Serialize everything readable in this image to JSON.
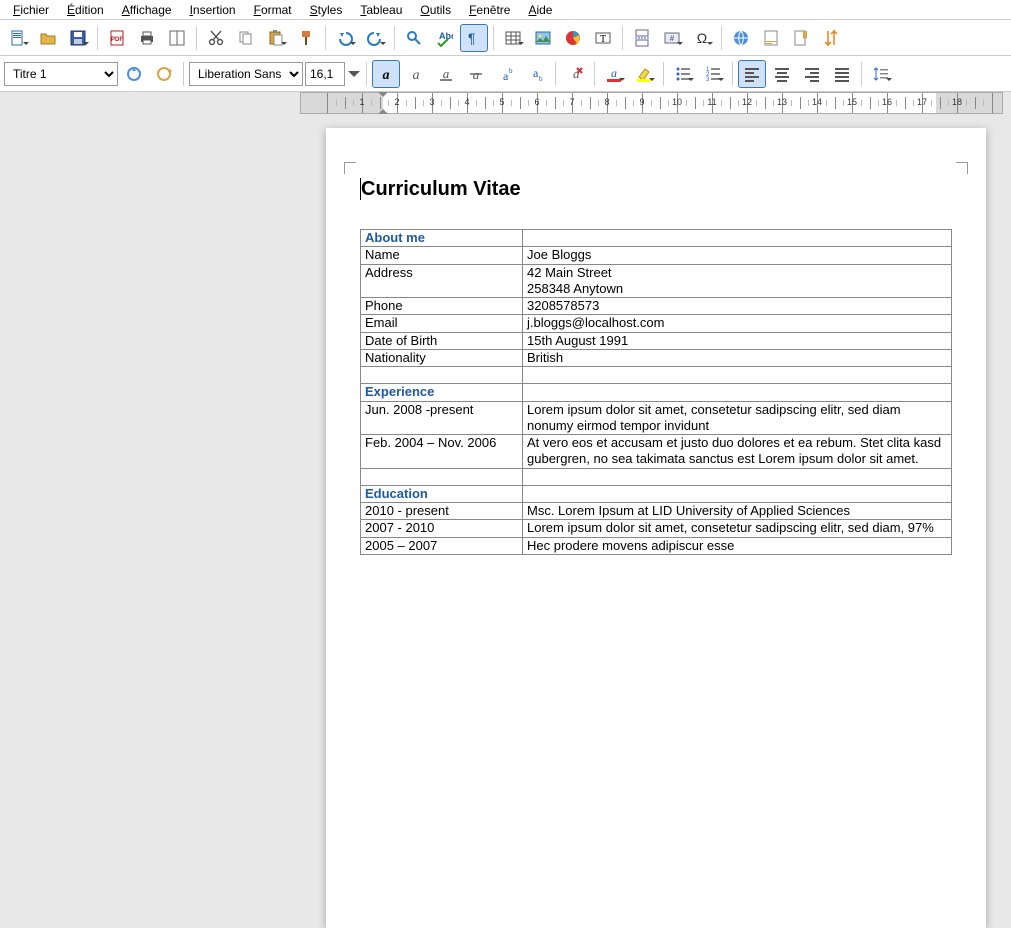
{
  "menu": [
    "Fichier",
    "Édition",
    "Affichage",
    "Insertion",
    "Format",
    "Styles",
    "Tableau",
    "Outils",
    "Fenêtre",
    "Aide"
  ],
  "styleCombo": "Titre 1",
  "fontCombo": "Liberation Sans",
  "sizeCombo": "16,1",
  "doc": {
    "title": "Curriculum Vitae",
    "sections": [
      {
        "header": "About me",
        "rows": [
          [
            "Name",
            "Joe Bloggs"
          ],
          [
            "Address",
            "42 Main Street\n258348 Anytown"
          ],
          [
            "Phone",
            "3208578573"
          ],
          [
            "Email",
            "j.bloggs@localhost.com"
          ],
          [
            "Date of Birth",
            "15th August 1991"
          ],
          [
            "Nationality",
            "British"
          ]
        ],
        "blankAfter": 1
      },
      {
        "header": "Experience",
        "rows": [
          [
            "Jun. 2008 -present",
            "Lorem ipsum dolor sit amet, consetetur sadipscing elitr, sed diam nonumy eirmod tempor invidunt"
          ],
          [
            "Feb. 2004 – Nov. 2006",
            "At vero eos et accusam et justo duo dolores et ea rebum. Stet clita kasd gubergren, no sea takimata sanctus est Lorem ipsum dolor sit amet."
          ]
        ],
        "blankAfter": 1
      },
      {
        "header": "Education",
        "rows": [
          [
            "2010 - present",
            "Msc. Lorem Ipsum at LID University of Applied Sciences"
          ],
          [
            "2007 - 2010",
            "Lorem ipsum dolor sit amet, consetetur sadipscing elitr, sed diam, 97%"
          ],
          [
            "2005 – 2007",
            "Hec prodere movens adipiscur esse"
          ]
        ],
        "blankAfter": 0
      }
    ]
  },
  "ruler": {
    "pxPerCm": 35,
    "marginCm": 1.6,
    "widthCm": 19,
    "numbers": [
      1,
      2,
      3,
      4,
      5,
      6,
      7,
      8,
      9,
      10,
      11,
      12,
      13,
      14,
      15,
      16,
      17,
      18
    ]
  }
}
